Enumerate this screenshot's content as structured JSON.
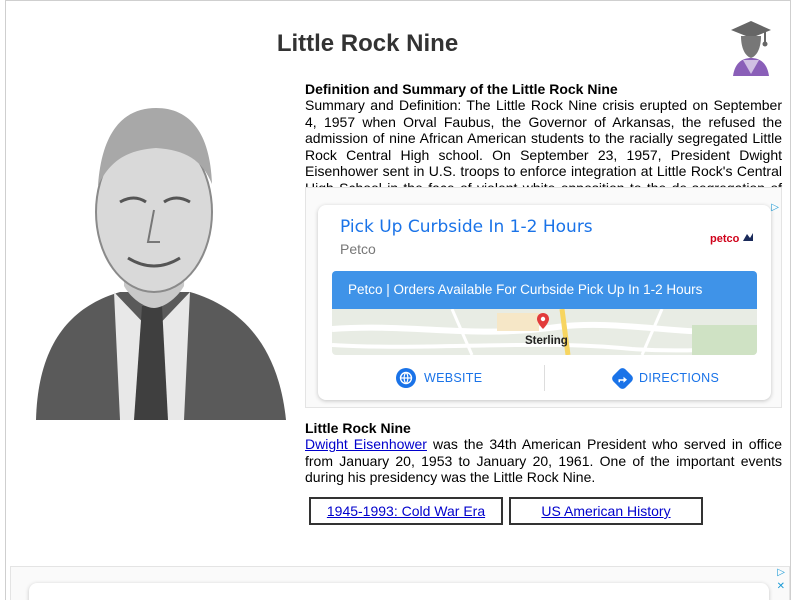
{
  "page": {
    "title": "Little Rock Nine"
  },
  "definition": {
    "heading": "Definition and Summary of the Little Rock Nine",
    "body": "Summary and Definition: The Little Rock Nine crisis erupted on September 4, 1957 when Orval Faubus, the Governor of Arkansas, the refused the admission of nine African American students to the racially segregated Little Rock Central High school. On September 23, 1957, President Dwight Eisenhower sent in U.S. troops to enforce integration at Little Rock's Central High School in the face of violent white opposition to the de-segregation of schools."
  },
  "ad": {
    "headline": "Pick Up Curbside In 1-2 Hours",
    "advertiser": "Petco",
    "brand": "petco",
    "banner": "Petco | Orders Available For Curbside Pick Up In 1-2 Hours",
    "map_label": "Sterling",
    "website_label": "WEBSITE",
    "directions_label": "DIRECTIONS",
    "adchoices_glyph": "▷",
    "adchoices_close": "✕"
  },
  "little_rock": {
    "heading": "Little Rock Nine",
    "link_text": "Dwight Eisenhower",
    "body_rest": " was the 34th American President who served in office from January 20, 1953 to January 20, 1961. One of the important events during his presidency was the Little Rock Nine."
  },
  "buttons": {
    "cold_war": "1945-1993: Cold War Era",
    "us_history": "US American History"
  },
  "colors": {
    "ad_link_blue": "#1a73e8",
    "banner_blue": "#3f93e8",
    "link_blue": "#0000cc",
    "petco_red": "#d0021b"
  }
}
